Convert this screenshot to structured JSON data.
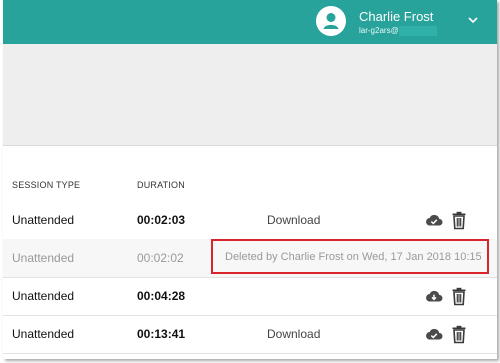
{
  "user": {
    "name": "Charlie Frost",
    "email_prefix": "lar-g2ars@"
  },
  "table": {
    "columns": {
      "session_type": "SESSION TYPE",
      "duration": "DURATION"
    },
    "rows": [
      {
        "type": "Unattended",
        "duration": "00:02:03",
        "action": "Download",
        "deleted": false
      },
      {
        "type": "Unattended",
        "duration": "00:02:02",
        "action": "Deleted by Charlie Frost on Wed, 17 Jan 2018 10:15",
        "deleted": true
      },
      {
        "type": "Unattended",
        "duration": "00:04:28",
        "action": "",
        "deleted": false
      },
      {
        "type": "Unattended",
        "duration": "00:13:41",
        "action": "Download",
        "deleted": false
      }
    ]
  },
  "icons": {
    "avatar": "user-icon",
    "menu": "chevron-down-icon",
    "cloud_done": "cloud-check-icon",
    "cloud_download": "cloud-download-icon",
    "delete": "trash-icon"
  },
  "colors": {
    "brand": "#27a39b",
    "highlight_border": "#d8242a"
  }
}
